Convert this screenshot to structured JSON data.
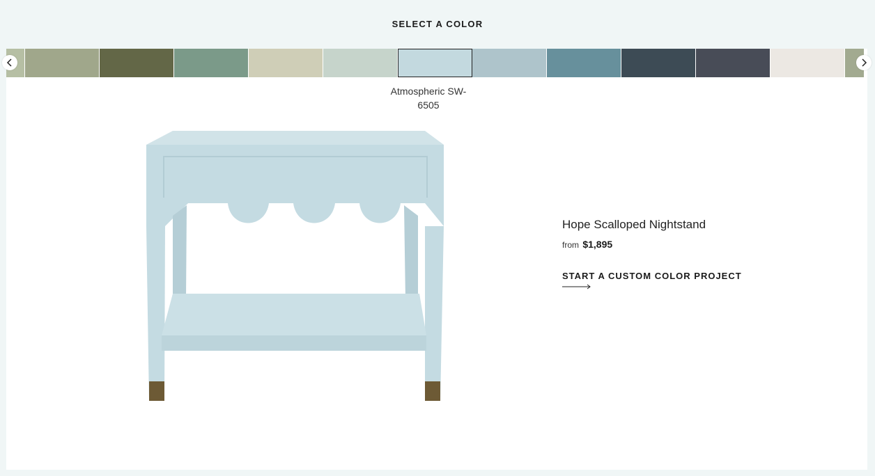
{
  "header": {
    "title": "SELECT A COLOR"
  },
  "swatches": [
    {
      "color": "#b6bfa4"
    },
    {
      "color": "#a0a78b"
    },
    {
      "color": "#636747"
    },
    {
      "color": "#7b9a89"
    },
    {
      "color": "#cfceb7"
    },
    {
      "color": "#c6d4cb"
    },
    {
      "color": "#c3d9df",
      "selected": true
    },
    {
      "color": "#aec4cb"
    },
    {
      "color": "#67909c"
    },
    {
      "color": "#3d4b55"
    },
    {
      "color": "#484c57"
    },
    {
      "color": "#ece8e3"
    },
    {
      "color": "#a2aa90"
    }
  ],
  "selected_color": {
    "label": "Atmospheric SW-6505"
  },
  "product": {
    "name": "Hope Scalloped Nightstand",
    "price_prefix": "from",
    "price": "$1,895",
    "cta": "START A CUSTOM COLOR PROJECT",
    "image_color": "#c4dbe2"
  },
  "icons": {
    "prev": "chevron-left-icon",
    "next": "chevron-right-icon",
    "cta": "long-arrow-right-icon"
  }
}
